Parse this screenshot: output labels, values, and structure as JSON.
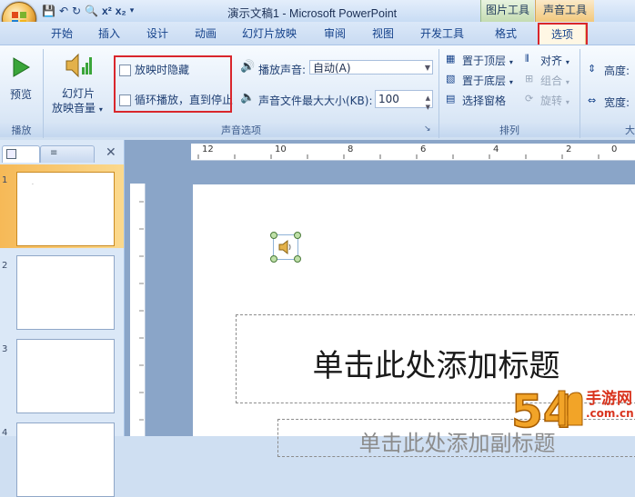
{
  "window": {
    "title": "演示文稿1 - Microsoft PowerPoint"
  },
  "context_tabs": {
    "picture_tools": "图片工具",
    "sound_tools": "声音工具"
  },
  "tabs": [
    "开始",
    "插入",
    "设计",
    "动画",
    "幻灯片放映",
    "审阅",
    "视图",
    "开发工具",
    "格式",
    "选项"
  ],
  "ribbon": {
    "play": {
      "preview_label": "预览",
      "group_label": "播放"
    },
    "sound_options": {
      "slideshow_volume_label_1": "幻灯片",
      "slideshow_volume_label_2": "放映音量",
      "hide_during_show": "放映时隐藏",
      "loop_until_stopped": "循环播放，直到停止",
      "play_sound_label": "播放声音:",
      "play_sound_value": "自动(A)",
      "max_size_label": "声音文件最大大小(KB):",
      "max_size_value": "100",
      "group_label": "声音选项"
    },
    "arrange": {
      "bring_to_front": "置于顶层",
      "send_to_back": "置于底层",
      "selection_pane": "选择窗格",
      "align": "对齐",
      "group": "组合",
      "rotate": "旋转",
      "group_label": "排列"
    },
    "size": {
      "height_label": "高度:",
      "width_label": "宽度:",
      "group_label": "大"
    }
  },
  "ruler": {
    "horizontal_start": "12",
    "horizontal_ticks": [
      "10",
      "8",
      "6",
      "4",
      "2",
      "0"
    ]
  },
  "slides": [
    {
      "number": "1"
    },
    {
      "number": "2"
    },
    {
      "number": "3"
    },
    {
      "number": "4"
    }
  ],
  "slide": {
    "title_placeholder": "单击此处添加标题",
    "subtitle_placeholder": "单击此处添加副标题"
  },
  "watermark": {
    "text": "手游网",
    "domain": ".com.cn"
  },
  "colors": {
    "highlight_red": "#d9262c",
    "selected_slide": "#f6b957",
    "sound_tab": "#f2c87c",
    "picture_tab": "#c4dcb2"
  }
}
